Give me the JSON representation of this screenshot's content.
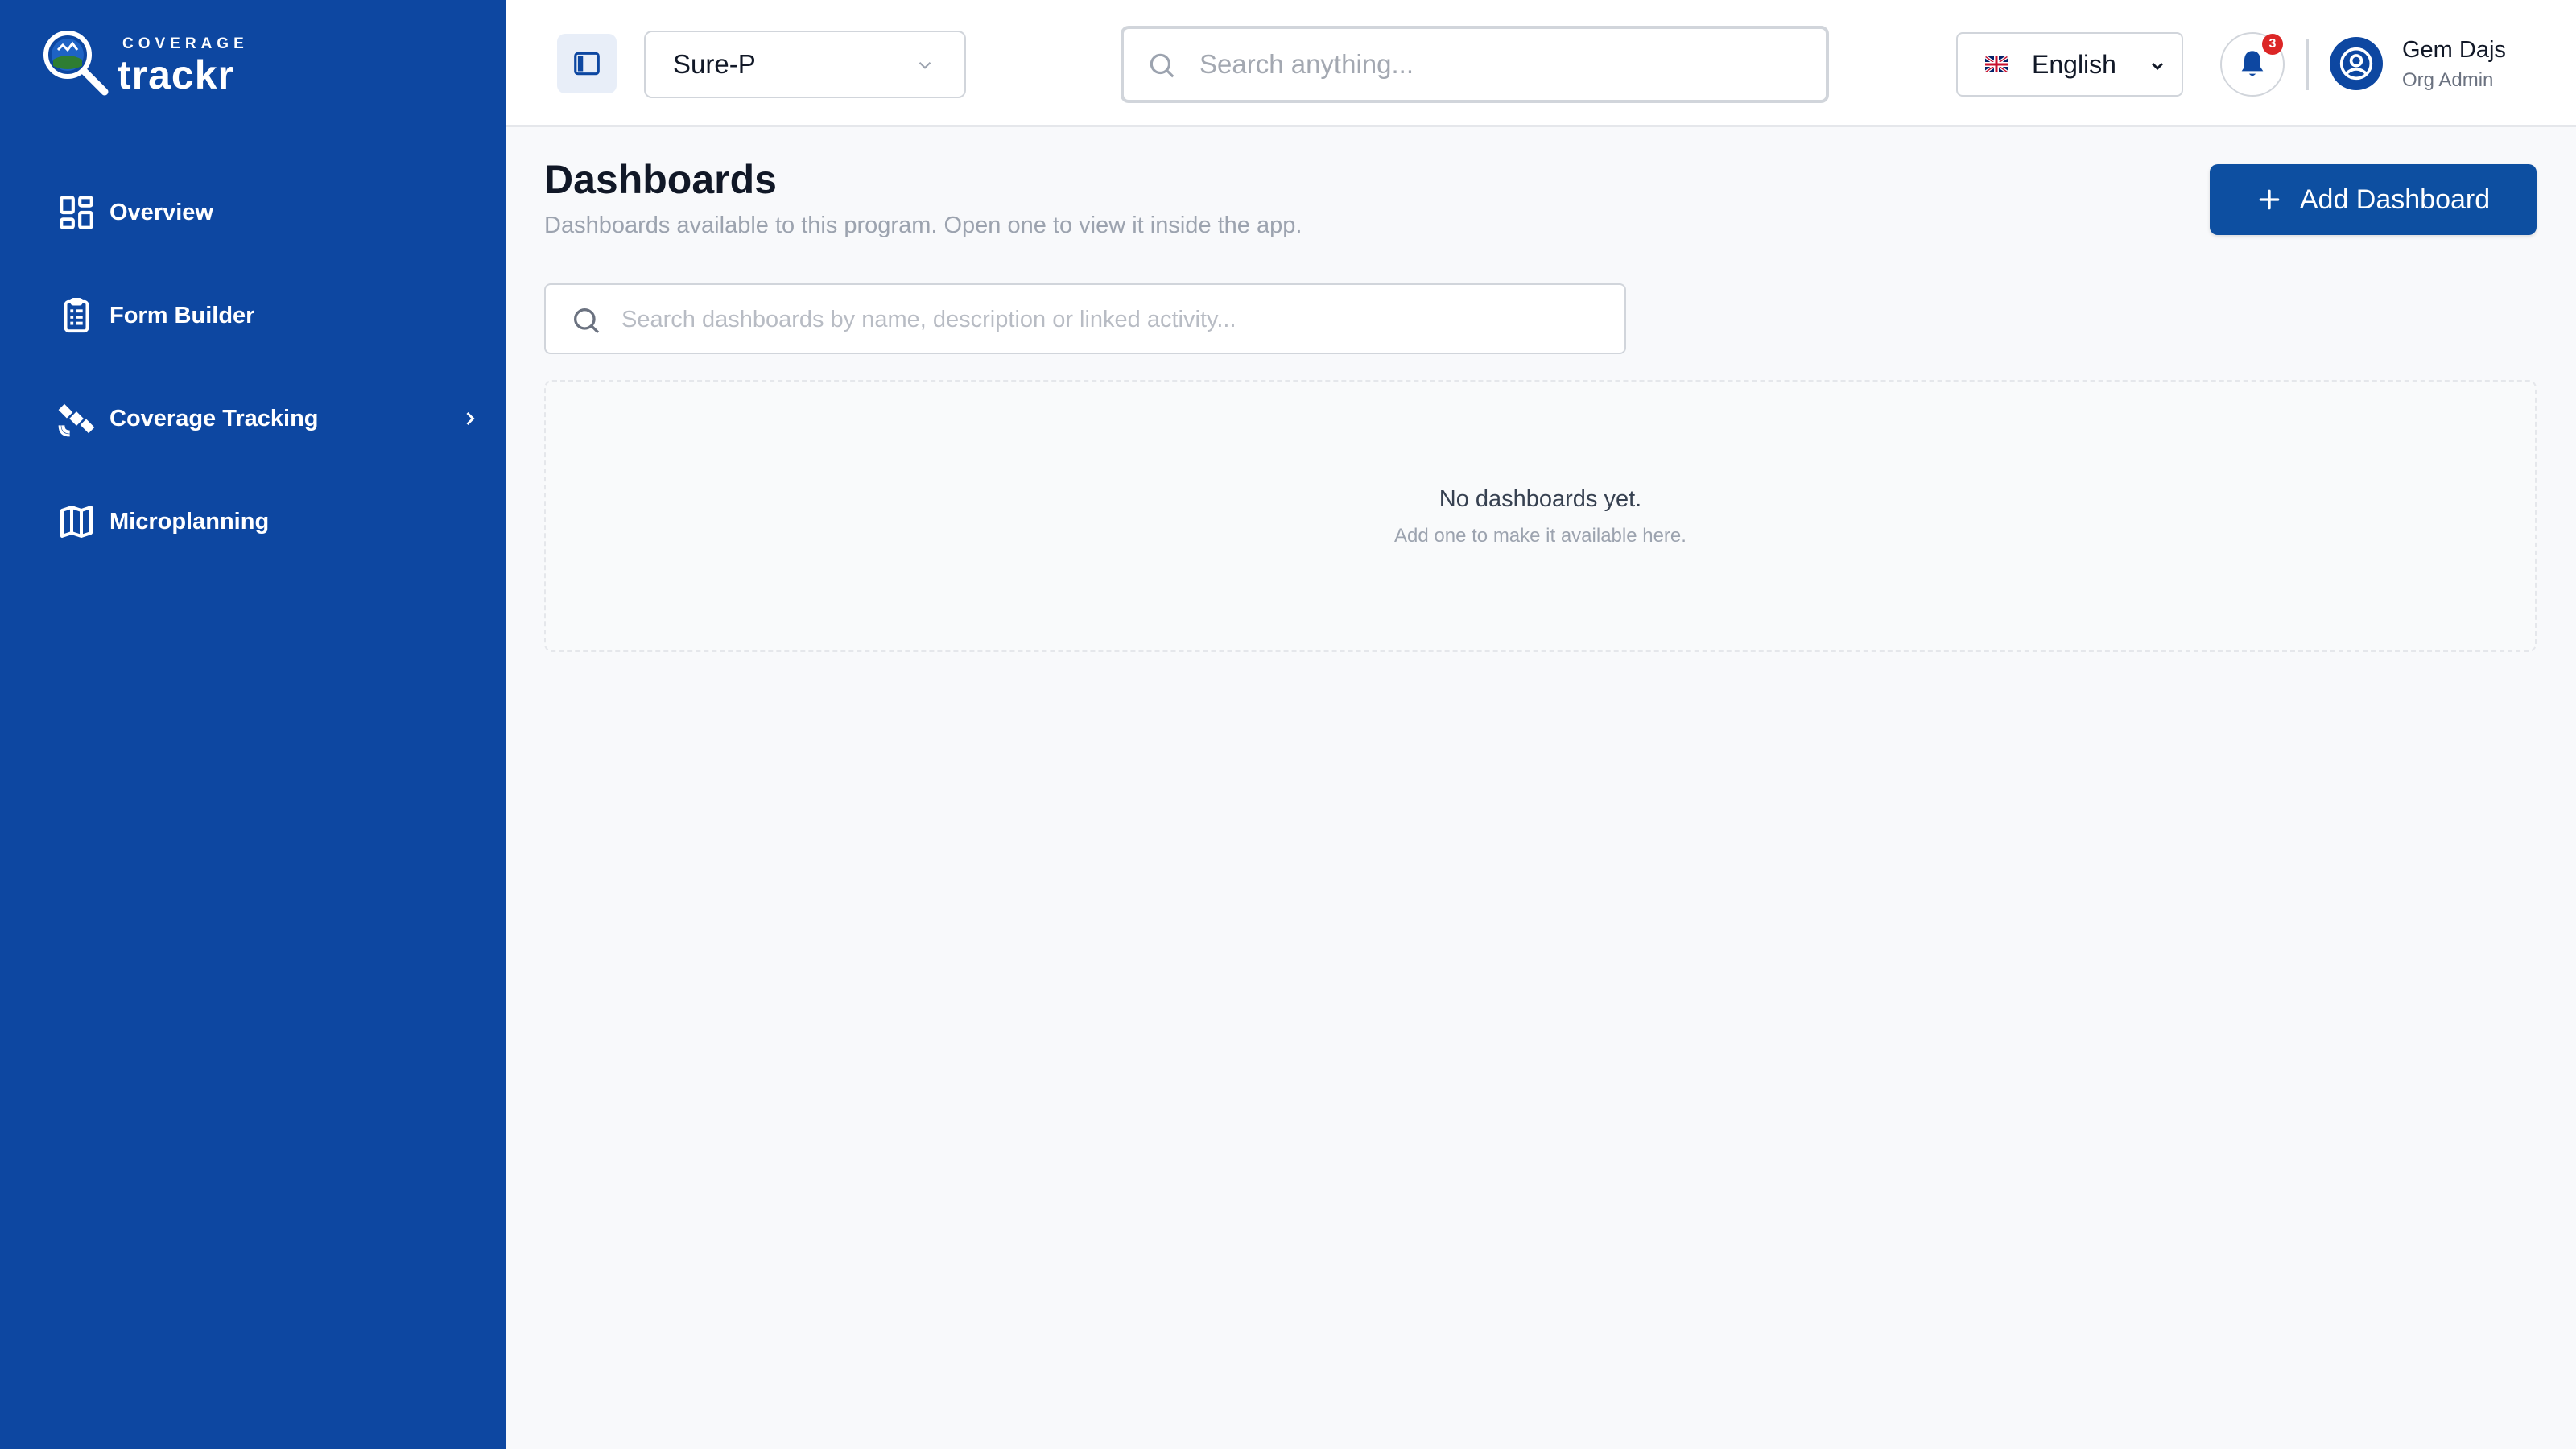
{
  "brand": {
    "top_text": "COVERAGE",
    "main_text": "trackr",
    "logo_icon": "magnifier-globe-logo"
  },
  "sidebar": {
    "items": [
      {
        "label": "Overview",
        "icon": "dashboard-grid-icon"
      },
      {
        "label": "Form Builder",
        "icon": "clipboard-list-icon"
      },
      {
        "label": "Coverage Tracking",
        "icon": "satellite-icon",
        "has_submenu": true
      },
      {
        "label": "Microplanning",
        "icon": "map-icon"
      }
    ]
  },
  "header": {
    "program": {
      "value": "Sure-P"
    },
    "search": {
      "placeholder": "Search anything..."
    },
    "language": {
      "value": "English",
      "flag": "uk-flag"
    },
    "notifications": {
      "count": "3"
    },
    "user": {
      "name": "Gem Dajs",
      "role": "Org Admin"
    }
  },
  "main": {
    "title": "Dashboards",
    "subtitle": "Dashboards available to this program. Open one to view it inside the app.",
    "add_button_label": "Add Dashboard",
    "search": {
      "placeholder": "Search dashboards by name, description or linked activity..."
    },
    "empty_state": {
      "title": "No dashboards yet.",
      "subtitle": "Add one to make it available here."
    }
  },
  "colors": {
    "sidebar_bg": "#0d47a1",
    "primary_button": "#0d4fa1",
    "page_bg": "#f8f9fb",
    "badge": "#dc2626"
  }
}
